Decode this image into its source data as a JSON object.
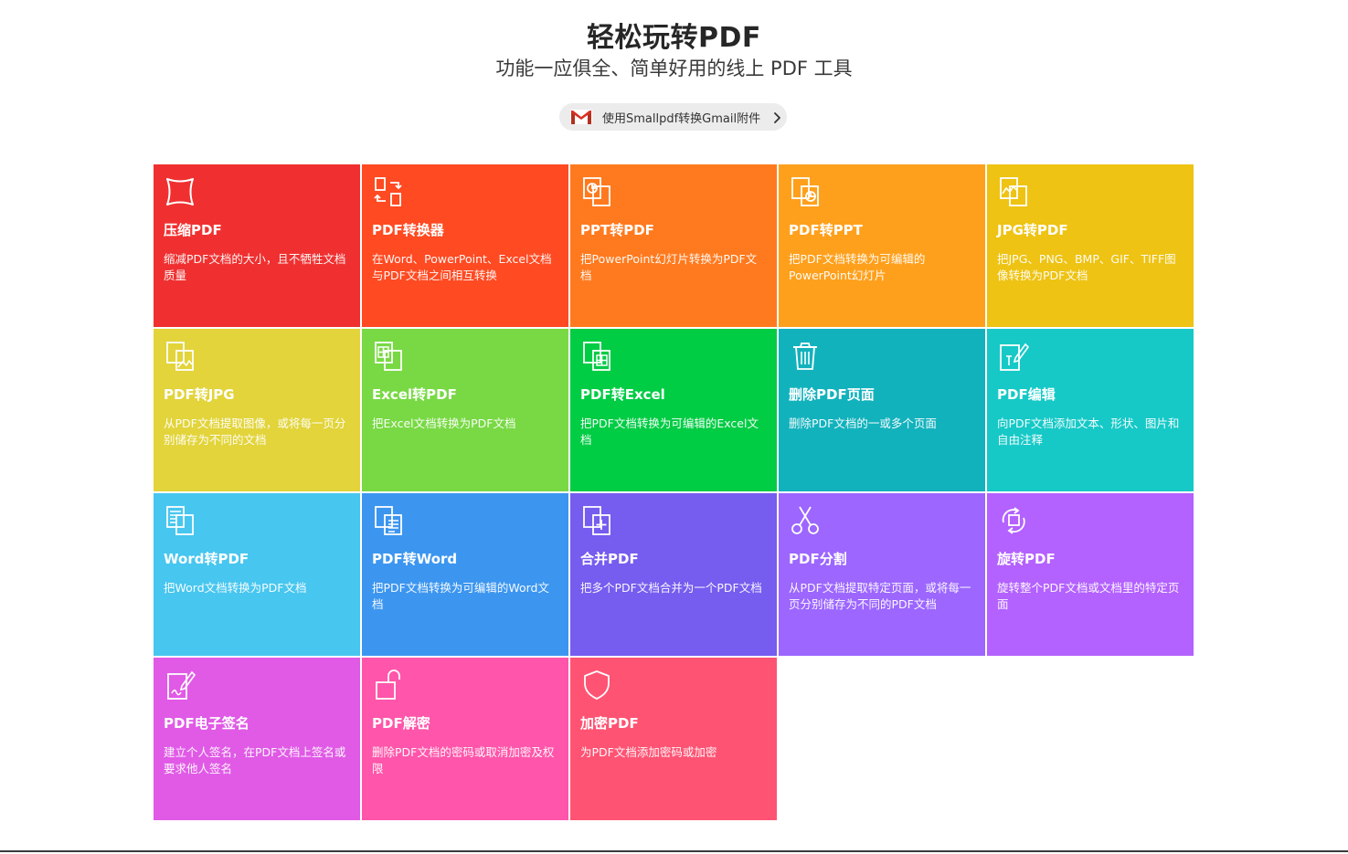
{
  "header": {
    "title": "轻松玩转PDF",
    "subtitle": "功能一应俱全、简单好用的线上 PDF 工具",
    "gmail_label": "使用Smallpdf转换Gmail附件"
  },
  "tools": [
    {
      "title": "压缩PDF",
      "desc": "缩减PDF文档的大小，且不牺牲文档质量",
      "color": "#f03030",
      "icon": "compress-icon"
    },
    {
      "title": "PDF转换器",
      "desc": "在Word、PowerPoint、Excel文档与PDF文档之间相互转换",
      "color": "#ff4a22",
      "icon": "convert-icon"
    },
    {
      "title": "PPT转PDF",
      "desc": "把PowerPoint幻灯片转换为PDF文档",
      "color": "#ff7a1e",
      "icon": "ppt-icon"
    },
    {
      "title": "PDF转PPT",
      "desc": "把PDF文档转换为可编辑的PowerPoint幻灯片",
      "color": "#ffa01c",
      "icon": "pdf-to-ppt-icon"
    },
    {
      "title": "JPG转PDF",
      "desc": "把JPG、PNG、BMP、GIF、TIFF图像转换为PDF文档",
      "color": "#eec313",
      "icon": "jpg-icon"
    },
    {
      "title": "PDF转JPG",
      "desc": "从PDF文档提取图像，或将每一页分别储存为不同的文档",
      "color": "#e2d43a",
      "icon": "pdf-to-jpg-icon"
    },
    {
      "title": "Excel转PDF",
      "desc": "把Excel文档转换为PDF文档",
      "color": "#78d944",
      "icon": "excel-icon"
    },
    {
      "title": "PDF转Excel",
      "desc": "把PDF文档转换为可编辑的Excel文档",
      "color": "#00cc44",
      "icon": "pdf-to-excel-icon"
    },
    {
      "title": "删除PDF页面",
      "desc": "删除PDF文档的一或多个页面",
      "color": "#12b2bd",
      "icon": "trash-icon"
    },
    {
      "title": "PDF编辑",
      "desc": "向PDF文档添加文本、形状、图片和自由注释",
      "color": "#16c9c7",
      "icon": "edit-icon"
    },
    {
      "title": "Word转PDF",
      "desc": "把Word文档转换为PDF文档",
      "color": "#47c6ef",
      "icon": "word-icon"
    },
    {
      "title": "PDF转Word",
      "desc": "把PDF文档转换为可编辑的Word文档",
      "color": "#3c96f0",
      "icon": "pdf-to-word-icon"
    },
    {
      "title": "合并PDF",
      "desc": "把多个PDF文档合并为一个PDF文档",
      "color": "#765cef",
      "icon": "merge-icon"
    },
    {
      "title": "PDF分割",
      "desc": "从PDF文档提取特定页面，或将每一页分别储存为不同的PDF文档",
      "color": "#9c66ff",
      "icon": "scissors-icon"
    },
    {
      "title": "旋转PDF",
      "desc": "旋转整个PDF文档或文档里的特定页面",
      "color": "#b361ff",
      "icon": "rotate-icon"
    },
    {
      "title": "PDF电子签名",
      "desc": "建立个人签名，在PDF文档上签名或要求他人签名",
      "color": "#e05ae6",
      "icon": "sign-icon"
    },
    {
      "title": "PDF解密",
      "desc": "删除PDF文档的密码或取消加密及权限",
      "color": "#ff55aa",
      "icon": "unlock-icon"
    },
    {
      "title": "加密PDF",
      "desc": "为PDF文档添加密码或加密",
      "color": "#ff5373",
      "icon": "shield-icon"
    }
  ]
}
